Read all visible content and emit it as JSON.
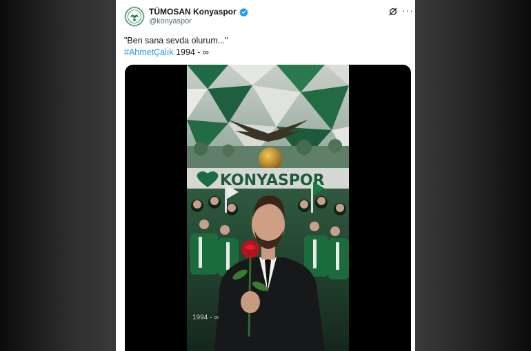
{
  "post": {
    "display_name": "TÜMOSAN Konyaspor",
    "handle": "@konyaspor",
    "text_line1": "\"Ben sana sevda olurum...\"",
    "hashtag": "#AhmetÇalık",
    "text_line2_rest": " 1994 - ∞",
    "more_label": "···"
  },
  "media": {
    "sign_text": "KONYASPOR",
    "overlay_text": "1994 - ∞"
  },
  "icons": {
    "verified": "verified-badge-icon",
    "grok": "grok-icon",
    "more": "more-icon"
  },
  "colors": {
    "accent": "#1d9bf0",
    "brand_green": "#0e6b3a"
  }
}
